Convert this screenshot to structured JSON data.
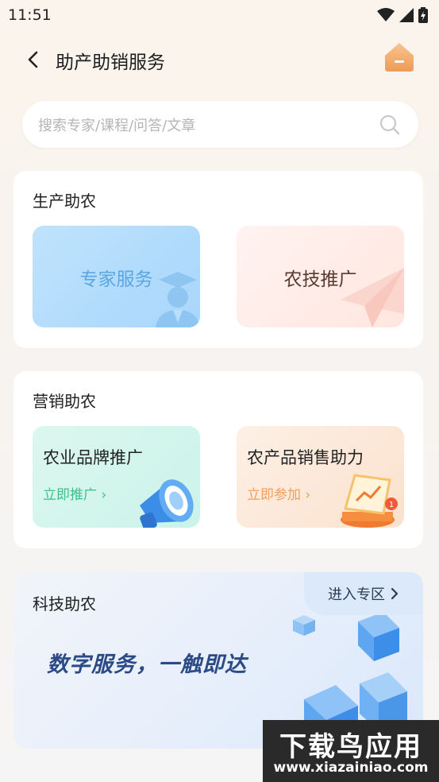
{
  "status_bar": {
    "time": "11:51"
  },
  "header": {
    "title": "助产助销服务"
  },
  "search": {
    "placeholder": "搜索专家/课程/问答/文章"
  },
  "production": {
    "title": "生产助农",
    "tiles": [
      {
        "label": "专家服务",
        "color": "#5aa7e3"
      },
      {
        "label": "农技推广",
        "color": "#5a3a2e"
      }
    ]
  },
  "marketing": {
    "title": "营销助农",
    "tiles": [
      {
        "label": "农业品牌推广",
        "link": "立即推广 ›",
        "link_color": "#3dbf8a"
      },
      {
        "label": "农产品销售助力",
        "link": "立即参加 ›",
        "link_color": "#f0a05c"
      }
    ]
  },
  "tech": {
    "title": "科技助农",
    "enter_label": "进入专区",
    "slogan": "数字服务，一触即达"
  },
  "watermark": {
    "title": "下载鸟应用",
    "url": "www.xiazainiao.com"
  }
}
